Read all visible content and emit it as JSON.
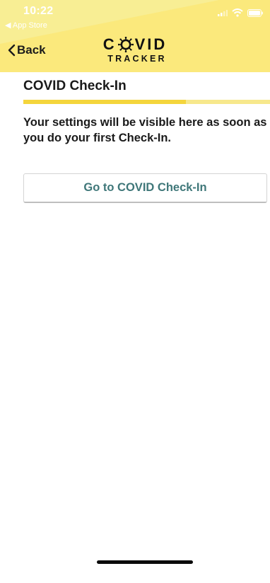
{
  "status_bar": {
    "time": "10:22",
    "back_app": "◀ App Store"
  },
  "nav": {
    "back_label": "Back"
  },
  "logo": {
    "main_left": "C",
    "main_right": "VID",
    "sub": "TRACKER"
  },
  "section": {
    "title": "COVID Check-In",
    "progress_filled_fraction": 0.66
  },
  "info": {
    "text": "Your settings will be visible here as soon as you do your first Check-In."
  },
  "actions": {
    "go_label": "Go to COVID Check-In"
  },
  "colors": {
    "header_bg": "#fbe97c",
    "progress_on": "#f4d53c",
    "progress_off": "#f7e88c",
    "button_text": "#3f7779"
  },
  "icons": {
    "back": "chevron-left-icon",
    "wifi": "wifi-icon",
    "signal": "signal-icon",
    "battery": "battery-icon",
    "virus": "virus-icon"
  }
}
